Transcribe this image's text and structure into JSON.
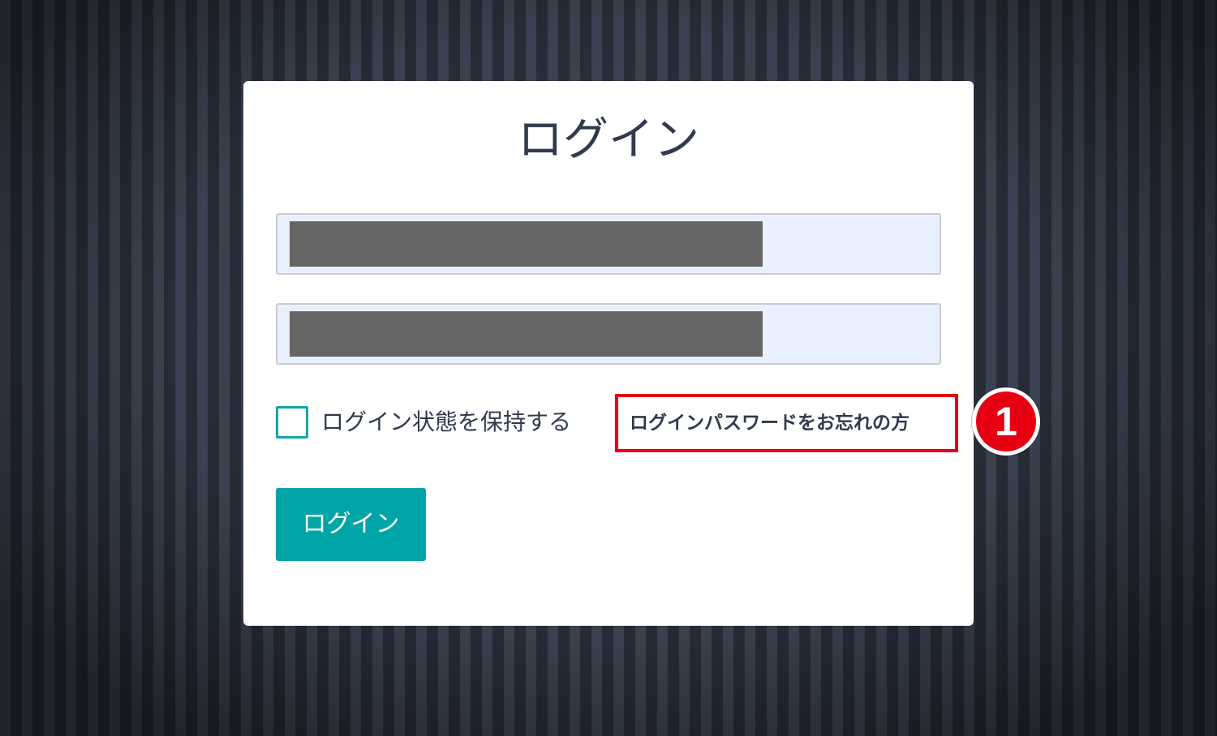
{
  "page": {
    "title": "ログイン"
  },
  "form": {
    "username_value": "",
    "password_value": "",
    "remember_label": "ログイン状態を保持する",
    "remember_checked": false,
    "forgot_link": "ログインパスワードをお忘れの方",
    "submit_label": "ログイン"
  },
  "annotation": {
    "step_number": "1",
    "highlight_color": "#e60012"
  },
  "colors": {
    "accent": "#00a5a8",
    "text": "#303a4c",
    "input_bg": "#e8f0fd"
  }
}
